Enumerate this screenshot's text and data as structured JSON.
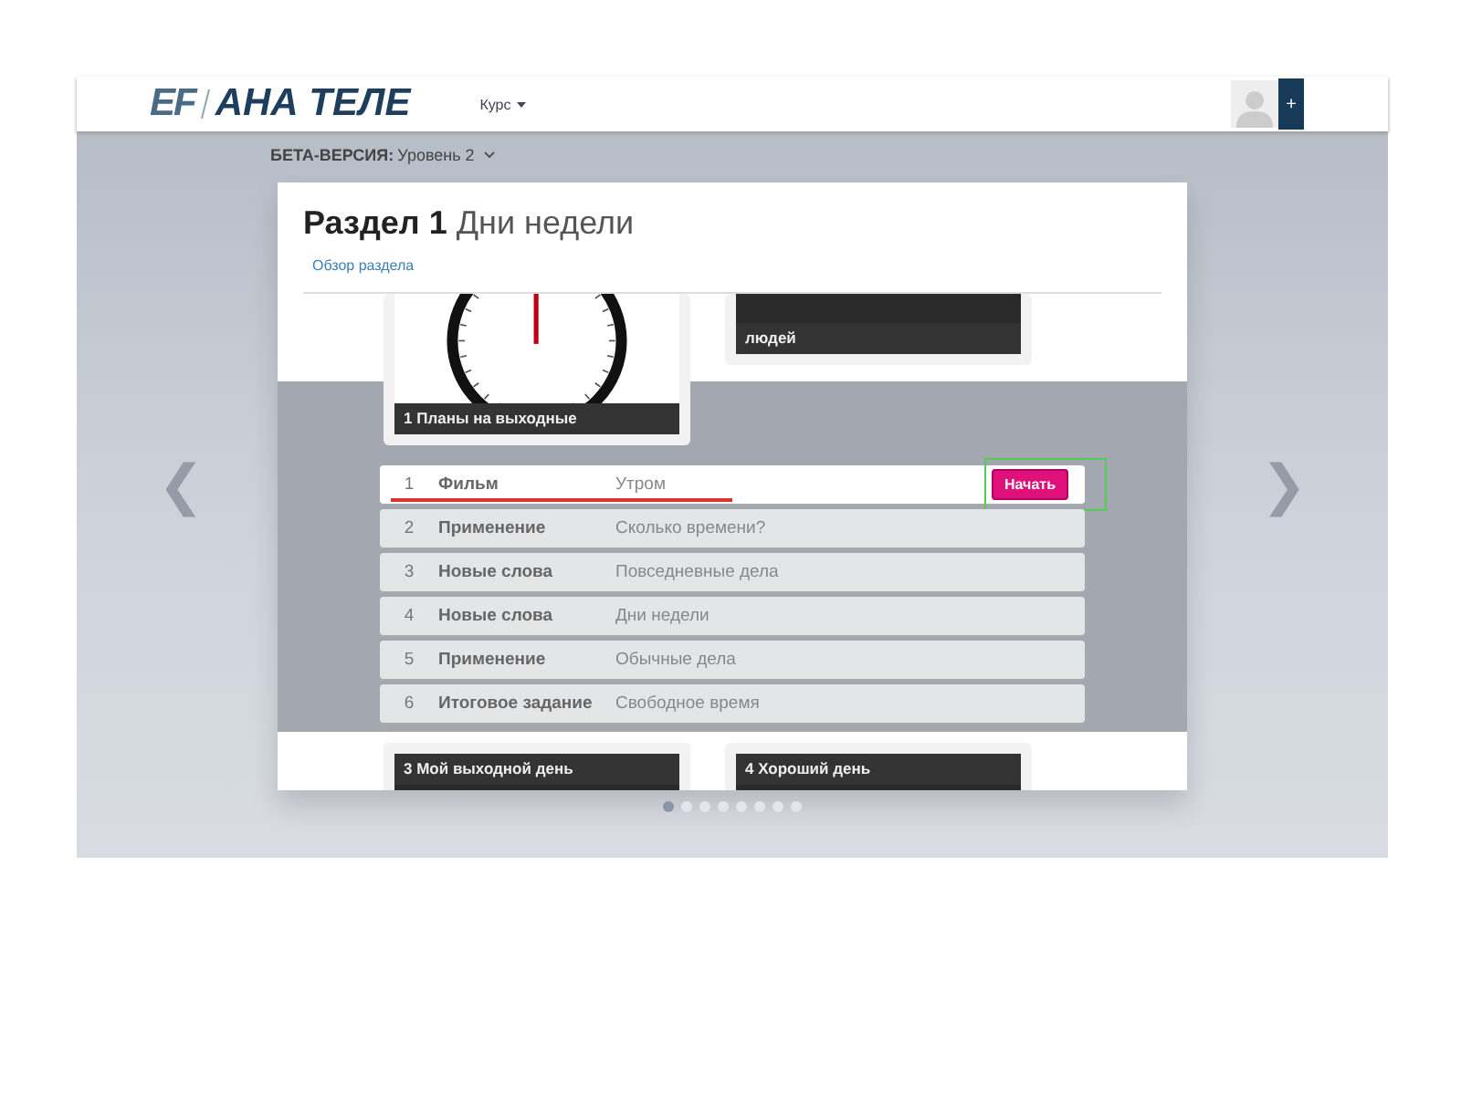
{
  "header": {
    "logo_mark": "EF",
    "logo_text": "АНА ТЕЛЕ",
    "menu": "Курс",
    "add_label": "+"
  },
  "level_bar": {
    "label": "БЕТА-ВЕРСИЯ:",
    "value": "Уровень 2"
  },
  "carousel": {
    "prev": "❮",
    "next": "❯",
    "dots": [
      {
        "selected": true
      },
      {
        "selected": false
      },
      {
        "selected": false
      },
      {
        "selected": false
      },
      {
        "selected": false
      },
      {
        "selected": false
      },
      {
        "selected": false
      },
      {
        "selected": false
      }
    ]
  },
  "unit": {
    "title_bold": "Раздел 1",
    "title": "Дни недели",
    "overview_link": "Обзор раздела",
    "top_tiles": [
      {
        "kind": "clock",
        "caption": "1 Планы на выходные"
      },
      {
        "kind": "photo",
        "caption": "людей"
      }
    ],
    "lessons": [
      {
        "number": "1",
        "type": "Фильм",
        "topic": "Утром",
        "selected": true,
        "action": "Начать"
      },
      {
        "number": "2",
        "type": "Применение",
        "topic": "Сколько времени?",
        "selected": false
      },
      {
        "number": "3",
        "type": "Новые слова",
        "topic": "Повседневные дела",
        "selected": false
      },
      {
        "number": "4",
        "type": "Новые слова",
        "topic": "Дни недели",
        "selected": false
      },
      {
        "number": "5",
        "type": "Применение",
        "topic": "Обычные дела",
        "selected": false
      },
      {
        "number": "6",
        "type": "Итоговое задание",
        "topic": "Свободное время",
        "selected": false
      }
    ],
    "bottom_tiles": [
      {
        "kind": "photo",
        "caption": "3 Мой выходной день"
      },
      {
        "kind": "photo",
        "caption": "4 Хороший день"
      }
    ]
  }
}
